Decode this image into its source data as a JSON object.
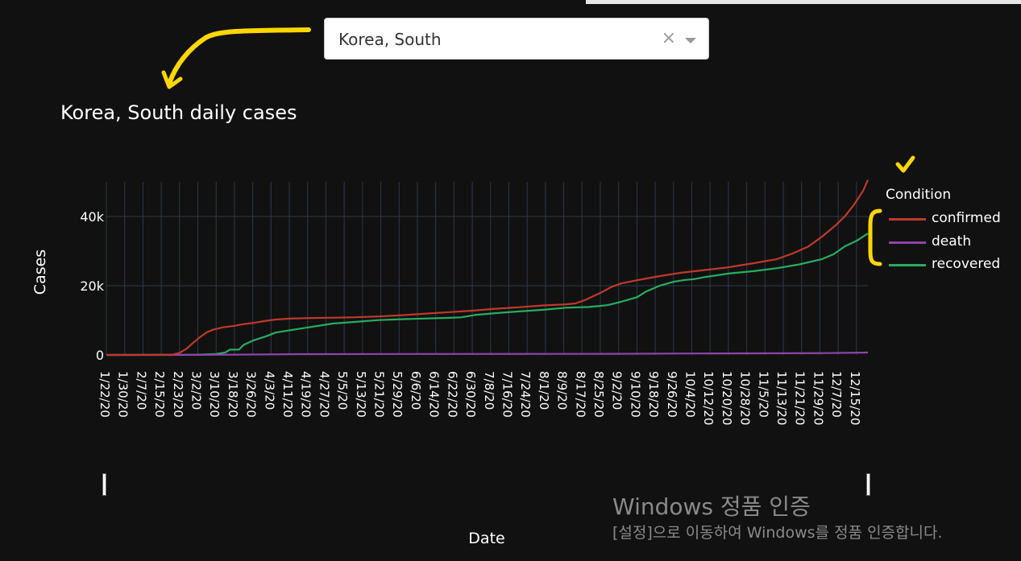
{
  "dropdown": {
    "value": "Korea, South",
    "clear": "×"
  },
  "watermark": {
    "title": "Windows 정품 인증",
    "subtitle": "[설정]으로 이동하여 Windows를 정품 인증합니다."
  },
  "chart_data": {
    "type": "line",
    "title": "Korea, South daily cases",
    "xlabel": "Date",
    "ylabel": "Cases",
    "legend_title": "Condition",
    "legend_position": "right",
    "grid": true,
    "ylim": [
      0,
      50000
    ],
    "xlim": [
      "1/22/20",
      "12/20/20"
    ],
    "x_tick_labels": [
      "1/22/20",
      "1/30/20",
      "2/7/20",
      "2/15/20",
      "2/23/20",
      "3/2/20",
      "3/10/20",
      "3/18/20",
      "3/26/20",
      "4/3/20",
      "4/11/20",
      "4/19/20",
      "4/27/20",
      "5/5/20",
      "5/13/20",
      "5/21/20",
      "5/29/20",
      "6/6/20",
      "6/14/20",
      "6/22/20",
      "6/30/20",
      "7/8/20",
      "7/16/20",
      "7/24/20",
      "8/1/20",
      "8/9/20",
      "8/17/20",
      "8/25/20",
      "9/2/20",
      "9/10/20",
      "9/18/20",
      "9/26/20",
      "10/4/20",
      "10/12/20",
      "10/20/20",
      "10/28/20",
      "11/5/20",
      "11/13/20",
      "11/21/20",
      "11/29/20",
      "12/7/20",
      "12/15/20"
    ],
    "y_ticks": [
      {
        "value": 0,
        "label": "0"
      },
      {
        "value": 20000,
        "label": "20k"
      },
      {
        "value": 40000,
        "label": "40k"
      }
    ],
    "series": [
      {
        "name": "confirmed",
        "color": "#c0392b",
        "points": [
          [
            "1/22/20",
            1
          ],
          [
            "2/15/20",
            28
          ],
          [
            "2/20/20",
            104
          ],
          [
            "2/23/20",
            602
          ],
          [
            "2/26/20",
            1766
          ],
          [
            "2/29/20",
            3526
          ],
          [
            "3/3/20",
            5186
          ],
          [
            "3/6/20",
            6593
          ],
          [
            "3/9/20",
            7382
          ],
          [
            "3/13/20",
            7979
          ],
          [
            "3/18/20",
            8413
          ],
          [
            "3/22/20",
            8897
          ],
          [
            "3/26/20",
            9241
          ],
          [
            "4/1/20",
            9887
          ],
          [
            "4/5/20",
            10237
          ],
          [
            "4/11/20",
            10480
          ],
          [
            "4/20/20",
            10674
          ],
          [
            "5/1/20",
            10774
          ],
          [
            "5/10/20",
            10874
          ],
          [
            "5/20/20",
            11110
          ],
          [
            "5/31/20",
            11503
          ],
          [
            "6/10/20",
            11947
          ],
          [
            "6/20/20",
            12373
          ],
          [
            "6/30/20",
            12800
          ],
          [
            "7/10/20",
            13338
          ],
          [
            "7/20/20",
            13771
          ],
          [
            "7/31/20",
            14305
          ],
          [
            "8/10/20",
            14626
          ],
          [
            "8/14/20",
            14873
          ],
          [
            "8/18/20",
            15761
          ],
          [
            "8/22/20",
            17002
          ],
          [
            "8/26/20",
            18265
          ],
          [
            "8/30/20",
            19699
          ],
          [
            "9/3/20",
            20644
          ],
          [
            "9/10/20",
            21588
          ],
          [
            "9/20/20",
            22783
          ],
          [
            "9/30/20",
            23812
          ],
          [
            "10/10/20",
            24548
          ],
          [
            "10/20/20",
            25333
          ],
          [
            "10/31/20",
            26511
          ],
          [
            "11/10/20",
            27653
          ],
          [
            "11/17/20",
            29311
          ],
          [
            "11/24/20",
            31353
          ],
          [
            "11/30/20",
            34201
          ],
          [
            "12/6/20",
            37546
          ],
          [
            "12/10/20",
            40098
          ],
          [
            "12/14/20",
            43484
          ],
          [
            "12/18/20",
            47515
          ],
          [
            "12/20/20",
            50591
          ]
        ]
      },
      {
        "name": "death",
        "color": "#8e44ad",
        "points": [
          [
            "1/22/20",
            0
          ],
          [
            "2/20/20",
            1
          ],
          [
            "3/1/20",
            17
          ],
          [
            "3/18/20",
            84
          ],
          [
            "4/15/20",
            225
          ],
          [
            "6/1/20",
            271
          ],
          [
            "8/1/20",
            300
          ],
          [
            "9/1/20",
            326
          ],
          [
            "10/1/20",
            415
          ],
          [
            "11/1/20",
            464
          ],
          [
            "12/1/20",
            526
          ],
          [
            "12/20/20",
            698
          ]
        ]
      },
      {
        "name": "recovered",
        "color": "#27ae60",
        "points": [
          [
            "1/22/20",
            0
          ],
          [
            "2/20/20",
            17
          ],
          [
            "3/1/20",
            30
          ],
          [
            "3/10/20",
            288
          ],
          [
            "3/14/20",
            714
          ],
          [
            "3/16/20",
            1540
          ],
          [
            "3/20/20",
            1540
          ],
          [
            "3/22/20",
            2909
          ],
          [
            "3/26/20",
            4144
          ],
          [
            "4/1/20",
            5408
          ],
          [
            "4/5/20",
            6463
          ],
          [
            "4/11/20",
            7117
          ],
          [
            "4/20/20",
            8042
          ],
          [
            "4/30/20",
            9072
          ],
          [
            "5/10/20",
            9568
          ],
          [
            "5/20/20",
            10066
          ],
          [
            "5/31/20",
            10340
          ],
          [
            "6/20/20",
            10718
          ],
          [
            "6/25/20",
            10856
          ],
          [
            "7/1/20",
            11537
          ],
          [
            "7/10/20",
            12065
          ],
          [
            "7/20/20",
            12552
          ],
          [
            "7/31/20",
            13043
          ],
          [
            "8/10/20",
            13654
          ],
          [
            "8/20/20",
            13863
          ],
          [
            "8/28/20",
            14381
          ],
          [
            "9/3/20",
            15356
          ],
          [
            "9/10/20",
            16666
          ],
          [
            "9/14/20",
            18330
          ],
          [
            "9/20/20",
            20024
          ],
          [
            "9/26/20",
            21131
          ],
          [
            "10/1/20",
            21666
          ],
          [
            "10/5/20",
            21898
          ],
          [
            "10/10/20",
            22535
          ],
          [
            "10/20/20",
            23505
          ],
          [
            "10/31/20",
            24214
          ],
          [
            "11/10/20",
            25052
          ],
          [
            "11/20/20",
            26154
          ],
          [
            "11/30/20",
            27702
          ],
          [
            "12/5/20",
            29082
          ],
          [
            "12/10/20",
            31387
          ],
          [
            "12/15/20",
            32947
          ],
          [
            "12/20/20",
            35091
          ]
        ]
      }
    ]
  }
}
